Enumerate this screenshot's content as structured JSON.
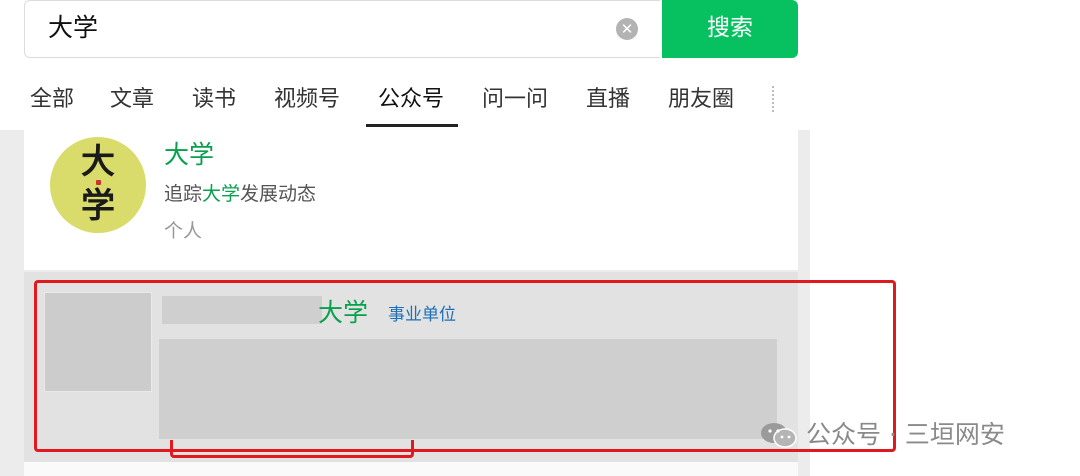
{
  "search": {
    "query": "大学",
    "button_label": "搜索"
  },
  "tabs": [
    {
      "label": "全部"
    },
    {
      "label": "文章"
    },
    {
      "label": "读书"
    },
    {
      "label": "视频号"
    },
    {
      "label": "公众号",
      "active": true
    },
    {
      "label": "问一问"
    },
    {
      "label": "直播"
    },
    {
      "label": "朋友圈"
    }
  ],
  "results": [
    {
      "name": "大学",
      "avatar_text": [
        "大",
        "学"
      ],
      "desc_prefix": "追踪",
      "desc_highlight": "大学",
      "desc_suffix": "发展动态",
      "type": "个人"
    },
    {
      "name_visible": "大学",
      "badge": "事业单位"
    }
  ],
  "watermark": {
    "text": "公众号 · 三垣网安",
    "icon": "wechat-icon"
  },
  "colors": {
    "accent": "#07c160",
    "highlight": "#07a14d",
    "annotation": "#e0191e",
    "badge": "#1d6fb8"
  }
}
